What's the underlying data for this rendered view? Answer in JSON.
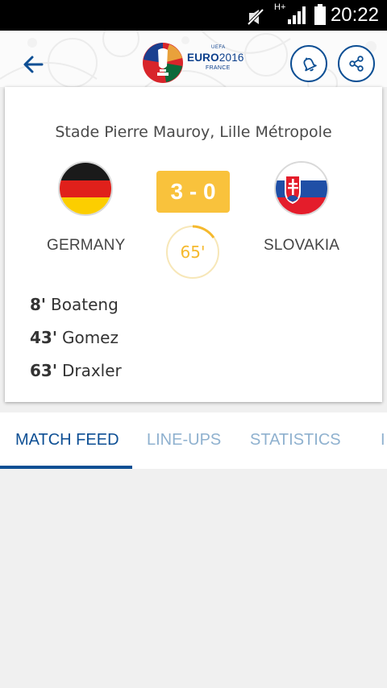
{
  "status_bar": {
    "time": "20:22",
    "network": "H+"
  },
  "header": {
    "logo": {
      "uefa": "UEFA",
      "euro": "EURO",
      "year": "2016",
      "country": "FRANCE"
    }
  },
  "match": {
    "venue": "Stade Pierre Mauroy, Lille Métropole",
    "home_team": "GERMANY",
    "away_team": "SLOVAKIA",
    "score": "3 - 0",
    "minute": "65'",
    "goals": [
      {
        "minute": "8'",
        "player": "Boateng"
      },
      {
        "minute": "43'",
        "player": "Gomez"
      },
      {
        "minute": "63'",
        "player": "Draxler"
      }
    ]
  },
  "tabs": [
    {
      "label": "MATCH FEED",
      "active": true
    },
    {
      "label": "LINE-UPS",
      "active": false
    },
    {
      "label": "STATISTICS",
      "active": false
    },
    {
      "label": "I",
      "active": false
    }
  ],
  "colors": {
    "brand_blue": "#0d4f94",
    "score_yellow": "#f9c23c",
    "tab_inactive": "#8fb1cf"
  },
  "icons": [
    "mute-icon",
    "signal-icon",
    "battery-icon",
    "back-arrow-icon",
    "bell-icon",
    "share-icon"
  ]
}
